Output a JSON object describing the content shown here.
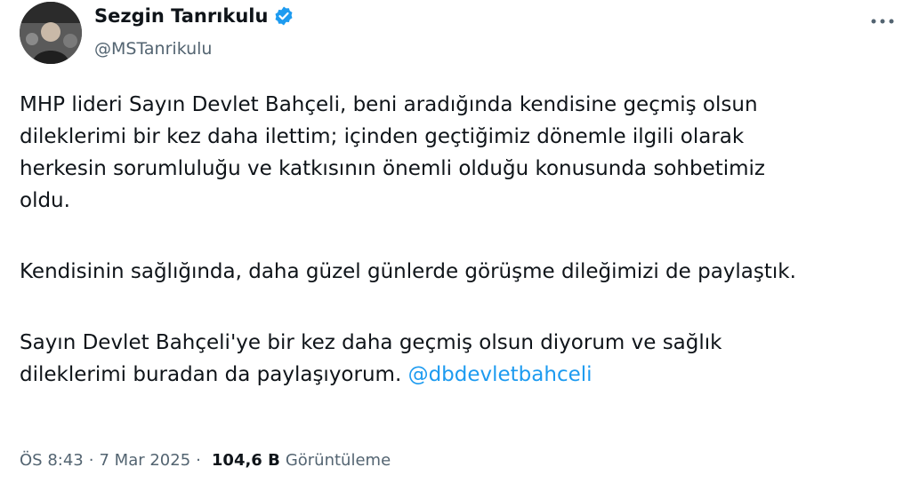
{
  "tweet": {
    "author_name": "Sezgin Tanrıkulu",
    "author_handle": "@MSTanrikulu",
    "paragraph_1": "MHP lideri Sayın Devlet Bahçeli, beni aradığında kendisine geçmiş olsun\ndileklerimi bir kez daha ilettim; içinden geçtiğimiz dönemle ilgili olarak\nherkesin sorumluluğu ve katkısının önemli olduğu konusunda sohbetimiz\noldu.",
    "paragraph_2": "Kendisinin sağlığında, daha güzel günlerde görüşme dileğimizi de paylaştık.",
    "paragraph_3": "Sayın Devlet Bahçeli'ye bir kez daha geçmiş olsun diyorum ve sağlık\ndileklerimi buradan da paylaşıyorum. ",
    "mention": "@dbdevletbahceli",
    "time": "ÖS 8:43",
    "separator": "·",
    "date": "7 Mar 2025",
    "views_count": "104,6 B",
    "views_label": "Görüntüleme"
  },
  "icons": {
    "verified": "verified-badge-icon",
    "more": "more-options-icon"
  },
  "colors": {
    "verified": "#1d9bf0",
    "mention": "#1d9bf0",
    "secondary_text": "#536471"
  }
}
